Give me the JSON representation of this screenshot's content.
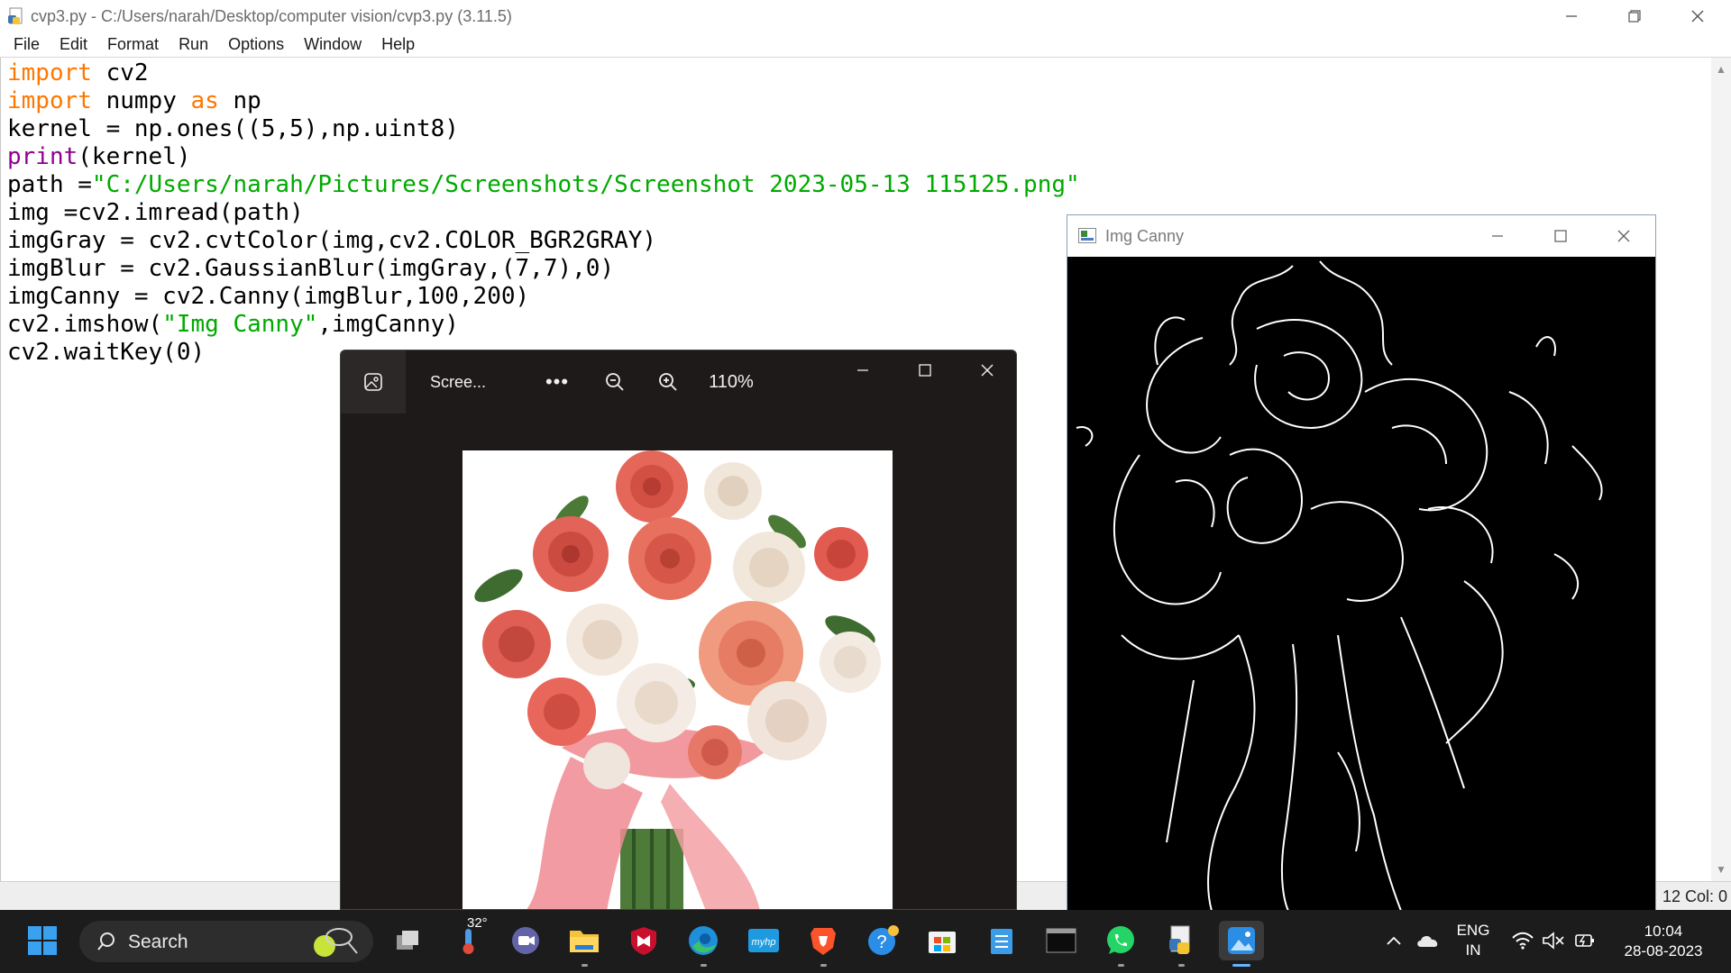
{
  "idle": {
    "window_title": "cvp3.py - C:/Users/narah/Desktop/computer vision/cvp3.py (3.11.5)",
    "menu": [
      "File",
      "Edit",
      "Format",
      "Run",
      "Options",
      "Window",
      "Help"
    ],
    "code": [
      [
        {
          "t": "import",
          "c": "kw"
        },
        {
          "t": " cv2",
          "c": ""
        }
      ],
      [
        {
          "t": "import",
          "c": "kw"
        },
        {
          "t": " numpy ",
          "c": ""
        },
        {
          "t": "as",
          "c": "kw"
        },
        {
          "t": " np",
          "c": ""
        }
      ],
      [
        {
          "t": "kernel = np.ones((5,5),np.uint8)",
          "c": ""
        }
      ],
      [
        {
          "t": "print",
          "c": "bi"
        },
        {
          "t": "(kernel)",
          "c": ""
        }
      ],
      [
        {
          "t": "path =",
          "c": ""
        },
        {
          "t": "\"C:/Users/narah/Pictures/Screenshots/Screenshot 2023-05-13 115125.png\"",
          "c": "st"
        }
      ],
      [
        {
          "t": "img =cv2.imread(path)",
          "c": ""
        }
      ],
      [
        {
          "t": "imgGray = cv2.cvtColor(img,cv2.COLOR_BGR2GRAY)",
          "c": ""
        }
      ],
      [
        {
          "t": "imgBlur = cv2.GaussianBlur(imgGray,(7,7),0)",
          "c": ""
        }
      ],
      [
        {
          "t": "imgCanny = cv2.Canny(imgBlur,100,200)",
          "c": ""
        }
      ],
      [
        {
          "t": "cv2.imshow(",
          "c": ""
        },
        {
          "t": "\"Img Canny\"",
          "c": "st"
        },
        {
          "t": ",imgCanny)",
          "c": ""
        }
      ],
      [
        {
          "t": "cv2.waitKey(0)",
          "c": ""
        }
      ]
    ],
    "status_position": "12  Col: 0"
  },
  "photos": {
    "file_name": "Scree...",
    "more_label": "•••",
    "zoom_level": "110%"
  },
  "canny": {
    "window_title": "Img Canny"
  },
  "taskbar": {
    "search_label": "Search",
    "weather_temp": "32°",
    "language": "ENG",
    "region": "IN",
    "time": "10:04",
    "date": "28-08-2023"
  },
  "colors": {
    "keyword": "#ff7700",
    "builtin": "#900090",
    "string": "#00aa00",
    "taskbar_bg": "#1c1c1c",
    "photos_bg": "#1f1a1a"
  }
}
